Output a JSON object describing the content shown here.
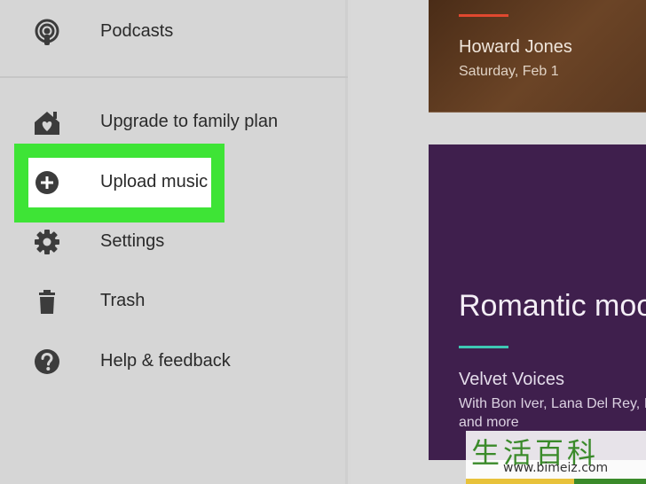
{
  "sidebar": {
    "items": [
      {
        "label": "Podcasts",
        "icon": "podcast-icon"
      },
      {
        "label": "Upgrade to family plan",
        "icon": "family-home-icon"
      },
      {
        "label": "Upload music",
        "icon": "add-circle-icon"
      },
      {
        "label": "Settings",
        "icon": "gear-icon"
      },
      {
        "label": "Trash",
        "icon": "trash-icon"
      },
      {
        "label": "Help & feedback",
        "icon": "help-icon"
      }
    ]
  },
  "cards": {
    "top": {
      "title": "Howard Jones",
      "subtitle": "Saturday, Feb 1",
      "accent_color": "#e0482f"
    },
    "purple": {
      "heading": "Romantic moo",
      "playlist": "Velvet Voices",
      "description": "With Bon Iver, Lana Del Rey, I and more",
      "accent_color": "#3ec8b4",
      "background": "#3f1f4d"
    }
  },
  "highlight": {
    "color": "#3ee436"
  },
  "watermark": {
    "text": "生活百科",
    "url": "www.bimeiz.com"
  }
}
